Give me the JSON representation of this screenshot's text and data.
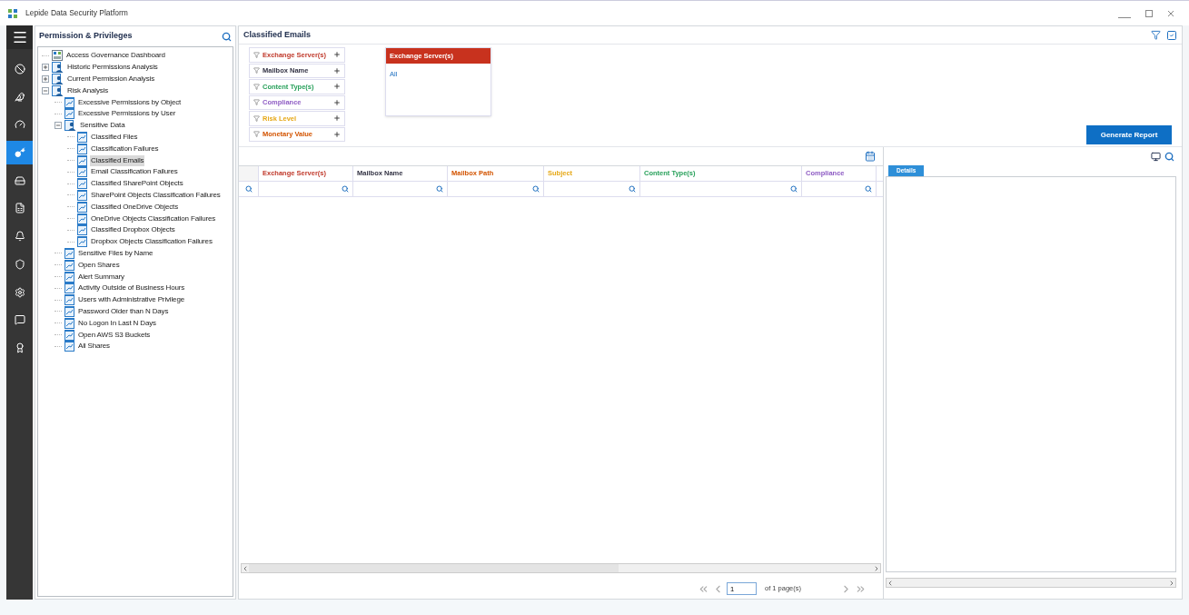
{
  "window": {
    "title": "Lepide Data Security Platform"
  },
  "rail": [
    {
      "selected": false
    },
    {
      "selected": false
    },
    {
      "selected": false
    },
    {
      "selected": true
    },
    {
      "selected": false
    },
    {
      "selected": false
    },
    {
      "selected": false
    },
    {
      "selected": false
    },
    {
      "selected": false
    },
    {
      "selected": false
    },
    {
      "selected": false
    }
  ],
  "sidebar": {
    "title": "Permission & Privileges",
    "tree": [
      {
        "kind": "dashboard",
        "label": "Access Governance Dashboard",
        "selected": false
      },
      {
        "kind": "folder",
        "label": "Historic Permissions Analysis",
        "selected": false,
        "expanded": false
      },
      {
        "kind": "folder",
        "label": "Current Permission Analysis",
        "selected": false,
        "expanded": false
      },
      {
        "kind": "folder",
        "label": "Risk Analysis",
        "selected": false,
        "expanded": true,
        "children": [
          {
            "kind": "report",
            "label": "Excessive Permissions by Object",
            "selected": false
          },
          {
            "kind": "report",
            "label": "Excessive Permissions by User",
            "selected": false
          },
          {
            "kind": "folder",
            "label": "Sensitive Data",
            "selected": false,
            "expanded": true,
            "children": [
              {
                "kind": "report",
                "label": "Classified Files",
                "selected": false
              },
              {
                "kind": "report",
                "label": "Classification Failures",
                "selected": false
              },
              {
                "kind": "report",
                "label": "Classified Emails",
                "selected": true
              },
              {
                "kind": "report",
                "label": "Email Classification Failures",
                "selected": false
              },
              {
                "kind": "report",
                "label": "Classified SharePoint Objects",
                "selected": false
              },
              {
                "kind": "report",
                "label": "SharePoint Objects Classification Failures",
                "selected": false
              },
              {
                "kind": "report",
                "label": "Classified OneDrive Objects",
                "selected": false
              },
              {
                "kind": "report",
                "label": "OneDrive Objects Classification Failures",
                "selected": false
              },
              {
                "kind": "report",
                "label": "Classified Dropbox Objects",
                "selected": false
              },
              {
                "kind": "report",
                "label": "Dropbox Objects Classification Failures",
                "selected": false
              }
            ]
          },
          {
            "kind": "report",
            "label": "Sensitive Files by Name",
            "selected": false
          },
          {
            "kind": "report",
            "label": "Open Shares",
            "selected": false
          },
          {
            "kind": "report",
            "label": "Alert Summary",
            "selected": false
          },
          {
            "kind": "report",
            "label": "Activity Outside of Business Hours",
            "selected": false
          },
          {
            "kind": "report",
            "label": "Users with Administrative Privilege",
            "selected": false
          },
          {
            "kind": "report",
            "label": "Password Older than N Days",
            "selected": false
          },
          {
            "kind": "report",
            "label": "No Logon In Last N Days",
            "selected": false
          },
          {
            "kind": "report",
            "label": "Open AWS S3 Buckets",
            "selected": false
          },
          {
            "kind": "report",
            "label": "All Shares",
            "selected": false
          }
        ]
      }
    ]
  },
  "report": {
    "title": "Classified Emails",
    "filters": [
      {
        "label": "Exchange Server(s)",
        "color": "#c0392b"
      },
      {
        "label": "Mailbox Name",
        "color": "#333344"
      },
      {
        "label": "Content Type(s)",
        "color": "#27a05a"
      },
      {
        "label": "Compliance",
        "color": "#8e5cc4"
      },
      {
        "label": "Risk Level",
        "color": "#e6a817"
      },
      {
        "label": "Monetary Value",
        "color": "#d35400"
      }
    ],
    "filter_card": {
      "title": "Exchange Server(s)",
      "value": "All"
    },
    "generate_button": "Generate Report",
    "table": {
      "columns": [
        {
          "label": "Exchange Server(s)",
          "color": "#c0392b"
        },
        {
          "label": "Mailbox Name",
          "color": "#333344"
        },
        {
          "label": "Mailbox Path",
          "color": "#d35400"
        },
        {
          "label": "Subject",
          "color": "#e6a817"
        },
        {
          "label": "Content Type(s)",
          "color": "#27a05a"
        },
        {
          "label": "Compliance",
          "color": "#8e5cc4"
        }
      ]
    },
    "pagination": {
      "page": "1",
      "of_pages": "of 1 page(s)"
    },
    "details": {
      "tab": "Details"
    }
  }
}
